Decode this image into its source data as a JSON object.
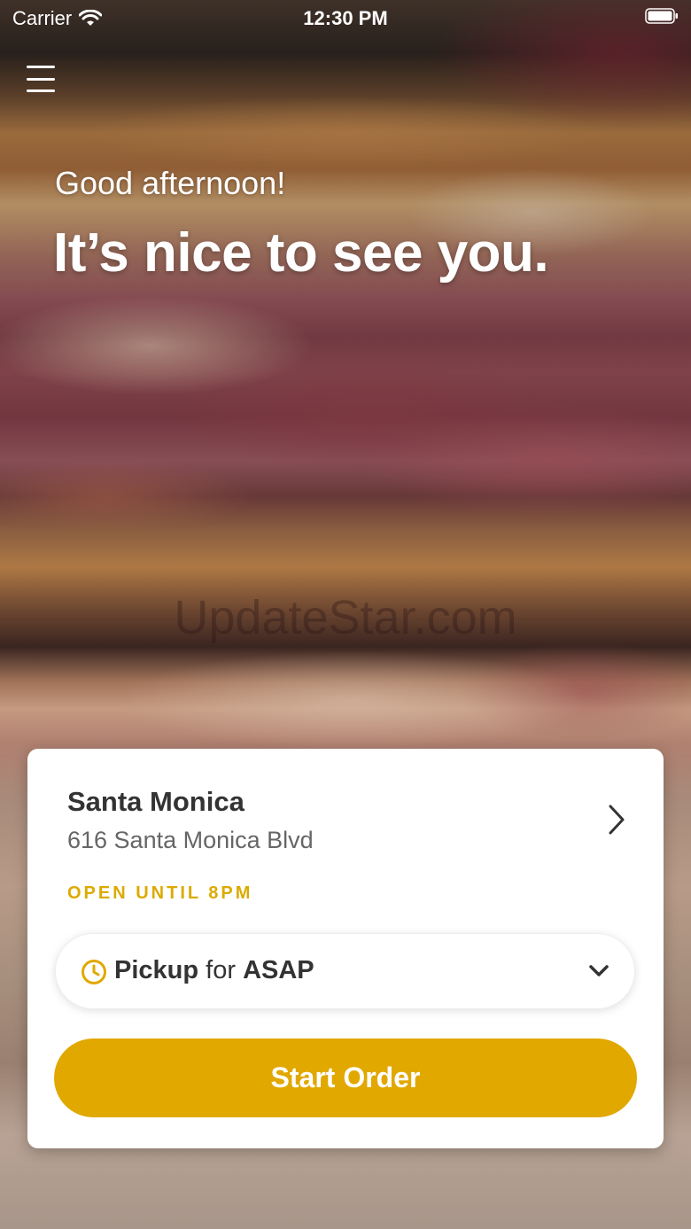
{
  "status_bar": {
    "carrier": "Carrier",
    "time": "12:30 PM",
    "wifi_icon": "wifi-icon",
    "battery_icon": "battery-icon"
  },
  "header": {
    "menu_icon": "hamburger-menu-icon"
  },
  "hero": {
    "greeting": "Good afternoon!",
    "headline": "It’s nice to see you.",
    "watermark": "UpdateStar.com"
  },
  "location_card": {
    "location": {
      "name": "Santa Monica",
      "address": "616 Santa Monica Blvd",
      "chevron_icon": "chevron-right-icon"
    },
    "hours": "OPEN UNTIL 8PM",
    "order_type": {
      "icon": "clock-icon",
      "mode": "Pickup",
      "connector": "for",
      "time": "ASAP",
      "chevron_icon": "chevron-down-icon"
    },
    "start_button_label": "Start Order"
  },
  "colors": {
    "accent": "#E1A800",
    "hours_text": "#DCAA00",
    "card_background": "#FFFFFF",
    "primary_text": "#333333",
    "secondary_text": "#666666"
  }
}
